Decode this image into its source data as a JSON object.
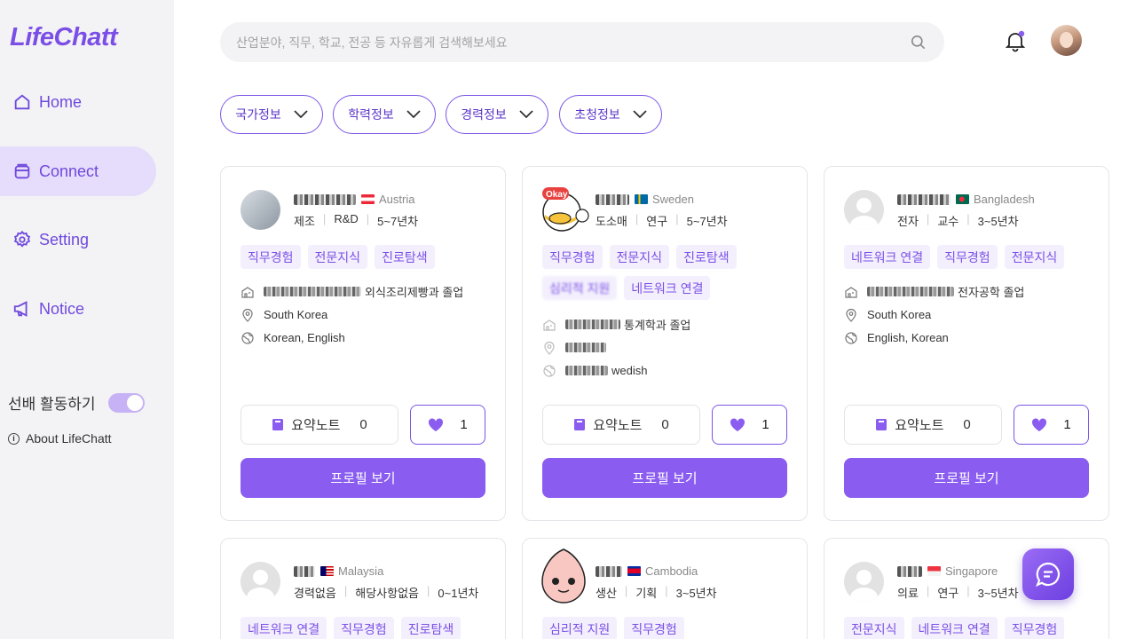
{
  "app": {
    "logo": "LifeChatt"
  },
  "sidebar": {
    "items": [
      {
        "label": "Home",
        "icon": "home-icon"
      },
      {
        "label": "Connect",
        "icon": "folder-icon",
        "active": true
      },
      {
        "label": "Setting",
        "icon": "gear-icon"
      },
      {
        "label": "Notice",
        "icon": "megaphone-icon"
      }
    ],
    "mentor_toggle_label": "선배 활동하기",
    "mentor_toggle_on": true,
    "about_label": "About LifeChatt"
  },
  "search": {
    "placeholder": "산업분야, 직무, 학교, 전공 등 자유롭게 검색해보세요"
  },
  "filters": [
    {
      "label": "국가정보"
    },
    {
      "label": "학력정보"
    },
    {
      "label": "경력정보"
    },
    {
      "label": "초청정보"
    }
  ],
  "colors": {
    "accent": "#8a5cf0",
    "accent_light": "#f3effd",
    "sidebar_bg": "#f3f3f6",
    "active_nav_bg": "#e6dcfb"
  },
  "cards": [
    {
      "country": "Austria",
      "meta": [
        "제조",
        "R&D",
        "5~7년차"
      ],
      "tags": [
        "직무경험",
        "전문지식",
        "진로탐색"
      ],
      "school": "외식조리제빵과 졸업",
      "location": "South Korea",
      "languages": "Korean, English",
      "note_label": "요약노트",
      "note_count": "0",
      "like_count": "1",
      "profile_label": "프로필 보기"
    },
    {
      "country": "Sweden",
      "meta": [
        "도소매",
        "연구",
        "5~7년차"
      ],
      "tags": [
        "직무경험",
        "전문지식",
        "진로탐색",
        "심리적 지원",
        "네트워크 연결"
      ],
      "school": "통계학과 졸업",
      "location": "",
      "languages": "wedish",
      "note_label": "요약노트",
      "note_count": "0",
      "like_count": "1",
      "profile_label": "프로필 보기"
    },
    {
      "country": "Bangladesh",
      "meta": [
        "전자",
        "교수",
        "3~5년차"
      ],
      "tags": [
        "네트워크 연결",
        "직무경험",
        "전문지식"
      ],
      "school": "전자공학 졸업",
      "location": "South Korea",
      "languages": "English, Korean",
      "note_label": "요약노트",
      "note_count": "0",
      "like_count": "1",
      "profile_label": "프로필 보기"
    },
    {
      "country": "Malaysia",
      "meta": [
        "경력없음",
        "해당사항없음",
        "0~1년차"
      ],
      "tags": [
        "네트워크 연결",
        "직무경험",
        "진로탐색"
      ]
    },
    {
      "country": "Cambodia",
      "meta": [
        "생산",
        "기획",
        "3~5년차"
      ],
      "tags": [
        "심리적 지원",
        "직무경험"
      ]
    },
    {
      "country": "Singapore",
      "meta": [
        "의료",
        "연구",
        "3~5년차"
      ],
      "tags": [
        "전문지식",
        "네트워크 연결",
        "직무경험"
      ]
    }
  ]
}
